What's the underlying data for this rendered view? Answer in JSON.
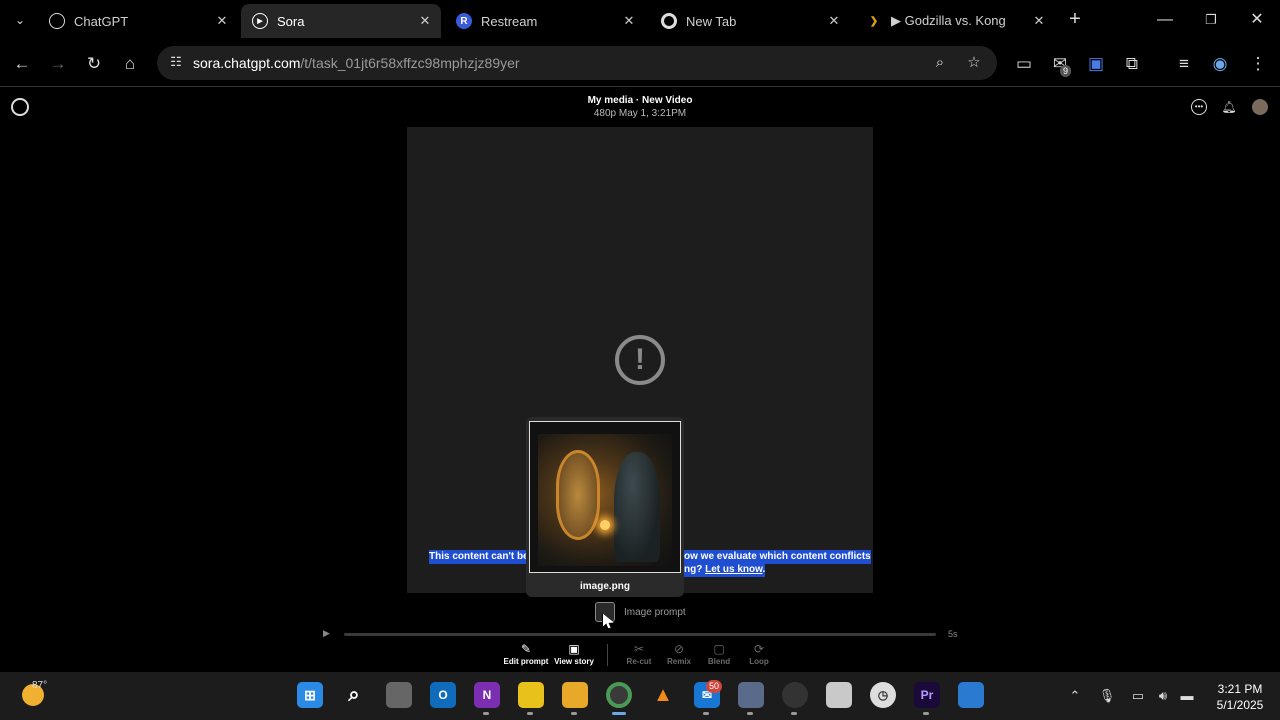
{
  "browser": {
    "tabs": [
      {
        "title": "ChatGPT",
        "favicon": "chatgpt-icon",
        "active": false
      },
      {
        "title": "Sora",
        "favicon": "sora-icon",
        "active": true
      },
      {
        "title": "Restream",
        "favicon": "restream-icon",
        "active": false
      },
      {
        "title": "New Tab",
        "favicon": "chrome-icon",
        "active": false
      },
      {
        "title": "▶ Godzilla vs. Kong",
        "favicon": "plex-icon",
        "active": false
      }
    ],
    "url_host": "sora.chatgpt.com",
    "url_path": "/t/task_01jt6r58xffzc98mphzjz89yer",
    "extension_badge": "9"
  },
  "header": {
    "title": "My media · New Video",
    "subtitle": "480p   May 1, 3:21PM"
  },
  "player": {
    "warning_line1_a": "This content can't be sl",
    "warning_line1_b": "ow we evaluate which content conflicts",
    "warning_line2_a": "ng?",
    "warning_link": "Let us know",
    "warning_line2_end": "."
  },
  "tooltip": {
    "filename": "image.png"
  },
  "prompt": {
    "label": "Image prompt"
  },
  "timeline": {
    "duration": "5s",
    "progress": 0
  },
  "actions": [
    {
      "label": "Edit prompt",
      "icon": "pencil-icon",
      "enabled": true
    },
    {
      "label": "View story",
      "icon": "story-icon",
      "enabled": true
    },
    {
      "label": "Re-cut",
      "icon": "scissors-icon",
      "enabled": false
    },
    {
      "label": "Remix",
      "icon": "remix-icon",
      "enabled": false
    },
    {
      "label": "Blend",
      "icon": "blend-icon",
      "enabled": false
    },
    {
      "label": "Loop",
      "icon": "loop-icon",
      "enabled": false
    }
  ],
  "taskbar": {
    "temperature": "87°",
    "mail_badge": "50",
    "time": "3:21 PM",
    "date": "5/1/2025"
  }
}
